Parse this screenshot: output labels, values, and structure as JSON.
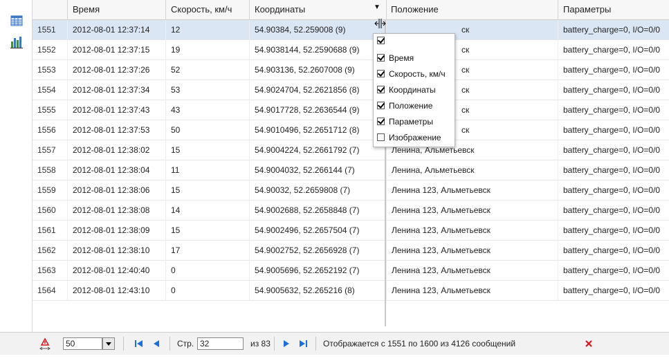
{
  "colors": {
    "selected_row": "#dbe6f5",
    "nav_blue": "#1e6fd9",
    "close_red": "#d9161d"
  },
  "sidebar": {
    "icons": [
      "table-icon",
      "bar-chart-icon"
    ]
  },
  "columns": [
    "",
    "Время",
    "Скорость, км/ч",
    "Координаты",
    "Положение",
    "Параметры"
  ],
  "rows": [
    {
      "n": "1551",
      "time": "2012-08-01 12:37:14",
      "speed": "12",
      "coords": "54.90384, 52.259008 (9)",
      "pos": "",
      "params": "battery_charge=0, I/O=0/0",
      "selected": true
    },
    {
      "n": "1552",
      "time": "2012-08-01 12:37:15",
      "speed": "19",
      "coords": "54.9038144, 52.2590688 (9)",
      "pos": "",
      "params": "battery_charge=0, I/O=0/0"
    },
    {
      "n": "1553",
      "time": "2012-08-01 12:37:26",
      "speed": "52",
      "coords": "54.903136, 52.2607008 (9)",
      "pos": "",
      "params": "battery_charge=0, I/O=0/0"
    },
    {
      "n": "1554",
      "time": "2012-08-01 12:37:34",
      "speed": "53",
      "coords": "54.9024704, 52.2621856 (8)",
      "pos": "",
      "params": "battery_charge=0, I/O=0/0"
    },
    {
      "n": "1555",
      "time": "2012-08-01 12:37:43",
      "speed": "43",
      "coords": "54.9017728, 52.2636544 (9)",
      "pos": "",
      "params": "battery_charge=0, I/O=0/0"
    },
    {
      "n": "1556",
      "time": "2012-08-01 12:37:53",
      "speed": "50",
      "coords": "54.9010496, 52.2651712 (8)",
      "pos": "",
      "params": "battery_charge=0, I/O=0/0"
    },
    {
      "n": "1557",
      "time": "2012-08-01 12:38:02",
      "speed": "15",
      "coords": "54.9004224, 52.2661792 (7)",
      "pos": "Ленина, Альметьевск",
      "params": "battery_charge=0, I/O=0/0"
    },
    {
      "n": "1558",
      "time": "2012-08-01 12:38:04",
      "speed": "11",
      "coords": "54.9004032, 52.266144 (7)",
      "pos": "Ленина, Альметьевск",
      "params": "battery_charge=0, I/O=0/0"
    },
    {
      "n": "1559",
      "time": "2012-08-01 12:38:06",
      "speed": "15",
      "coords": "54.90032, 52.2659808 (7)",
      "pos": "Ленина 123, Альметьевск",
      "params": "battery_charge=0, I/O=0/0"
    },
    {
      "n": "1560",
      "time": "2012-08-01 12:38:08",
      "speed": "14",
      "coords": "54.9002688, 52.2658848 (7)",
      "pos": "Ленина 123, Альметьевск",
      "params": "battery_charge=0, I/O=0/0"
    },
    {
      "n": "1561",
      "time": "2012-08-01 12:38:09",
      "speed": "15",
      "coords": "54.9002496, 52.2657504 (7)",
      "pos": "Ленина 123, Альметьевск",
      "params": "battery_charge=0, I/O=0/0"
    },
    {
      "n": "1562",
      "time": "2012-08-01 12:38:10",
      "speed": "17",
      "coords": "54.9002752, 52.2656928 (7)",
      "pos": "Ленина 123, Альметьевск",
      "params": "battery_charge=0, I/O=0/0"
    },
    {
      "n": "1563",
      "time": "2012-08-01 12:40:40",
      "speed": "0",
      "coords": "54.9005696, 52.2652192 (7)",
      "pos": "Ленина 123, Альметьевск",
      "params": "battery_charge=0, I/O=0/0"
    },
    {
      "n": "1564",
      "time": "2012-08-01 12:43:10",
      "speed": "0",
      "coords": "54.9005632, 52.265216 (8)",
      "pos": "Ленина 123, Альметьевск",
      "params": "battery_charge=0, I/O=0/0"
    }
  ],
  "partial_pos": "ск",
  "column_menu": {
    "items": [
      {
        "label": "",
        "checked": true
      },
      {
        "label": "Время",
        "checked": true
      },
      {
        "label": "Скорость, км/ч",
        "checked": true
      },
      {
        "label": "Координаты",
        "checked": true
      },
      {
        "label": "Положение",
        "checked": true
      },
      {
        "label": "Параметры",
        "checked": true
      },
      {
        "label": "Изображение",
        "checked": false
      }
    ]
  },
  "toolbar": {
    "page_size": "50",
    "page_label": "Стр.",
    "page_value": "32",
    "page_total": "из 83",
    "status": "Отображается с 1551 по 1600 из 4126 сообщений"
  }
}
